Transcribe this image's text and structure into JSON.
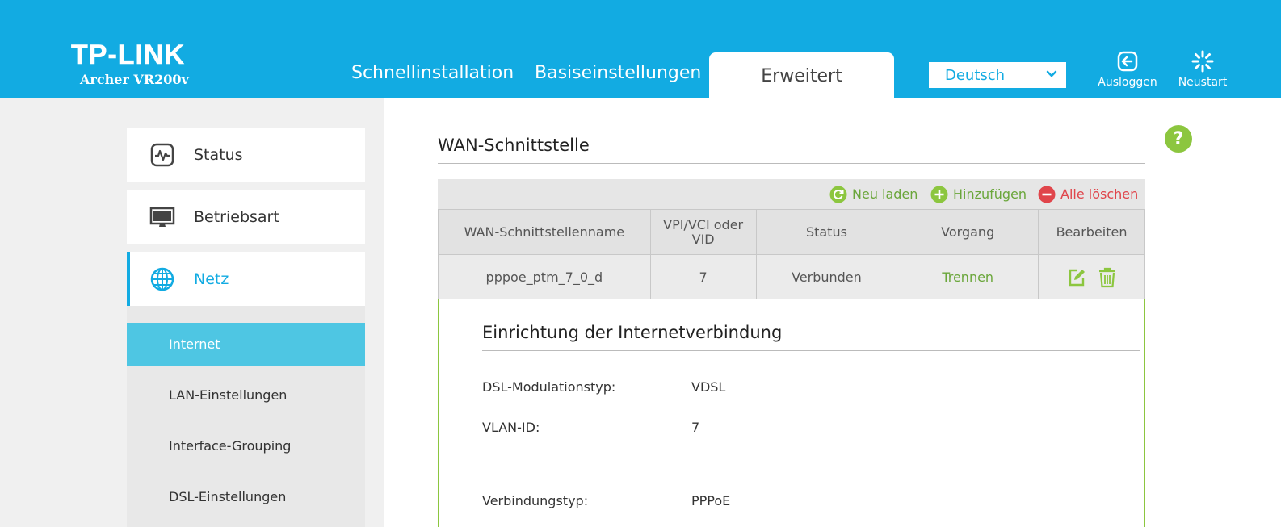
{
  "brand": {
    "logo": "TP-LINK",
    "model": "Archer VR200v"
  },
  "nav": {
    "tabs": [
      "Schnellinstallation",
      "Basiseinstellungen",
      "Erweitert"
    ],
    "active": "Erweitert"
  },
  "language": {
    "selected": "Deutsch"
  },
  "header_buttons": {
    "logout": "Ausloggen",
    "restart": "Neustart"
  },
  "sidebar": {
    "items": [
      {
        "label": "Status",
        "icon": "status-icon"
      },
      {
        "label": "Betriebsart",
        "icon": "monitor-icon"
      },
      {
        "label": "Netz",
        "icon": "globe-icon",
        "active": true
      }
    ],
    "subitems": [
      {
        "label": "Internet",
        "active": true
      },
      {
        "label": "LAN-Einstellungen"
      },
      {
        "label": "Interface-Grouping"
      },
      {
        "label": "DSL-Einstellungen"
      }
    ]
  },
  "help": {
    "label": "?"
  },
  "main": {
    "title": "WAN-Schnittstelle",
    "toolbar": {
      "reload": "Neu laden",
      "add": "Hinzufügen",
      "delete_all": "Alle löschen"
    },
    "table": {
      "headers": [
        "WAN-Schnittstellenname",
        "VPI/VCI oder VID",
        "Status",
        "Vorgang",
        "Bearbeiten"
      ],
      "rows": [
        {
          "name": "pppoe_ptm_7_0_d",
          "vid": "7",
          "status": "Verbunden",
          "action": "Trennen"
        }
      ]
    },
    "detail": {
      "title": "Einrichtung der Internetverbindung",
      "fields": [
        {
          "label": "DSL-Modulationstyp:",
          "value": "VDSL"
        },
        {
          "label": "VLAN-ID:",
          "value": "7"
        },
        {
          "label": "Verbindungstyp:",
          "value": "PPPoE"
        }
      ]
    }
  },
  "colors": {
    "header": "#12abe2",
    "accent_green": "#8cc63f",
    "danger": "#e0454b",
    "sub_active": "#4ec6e3"
  }
}
